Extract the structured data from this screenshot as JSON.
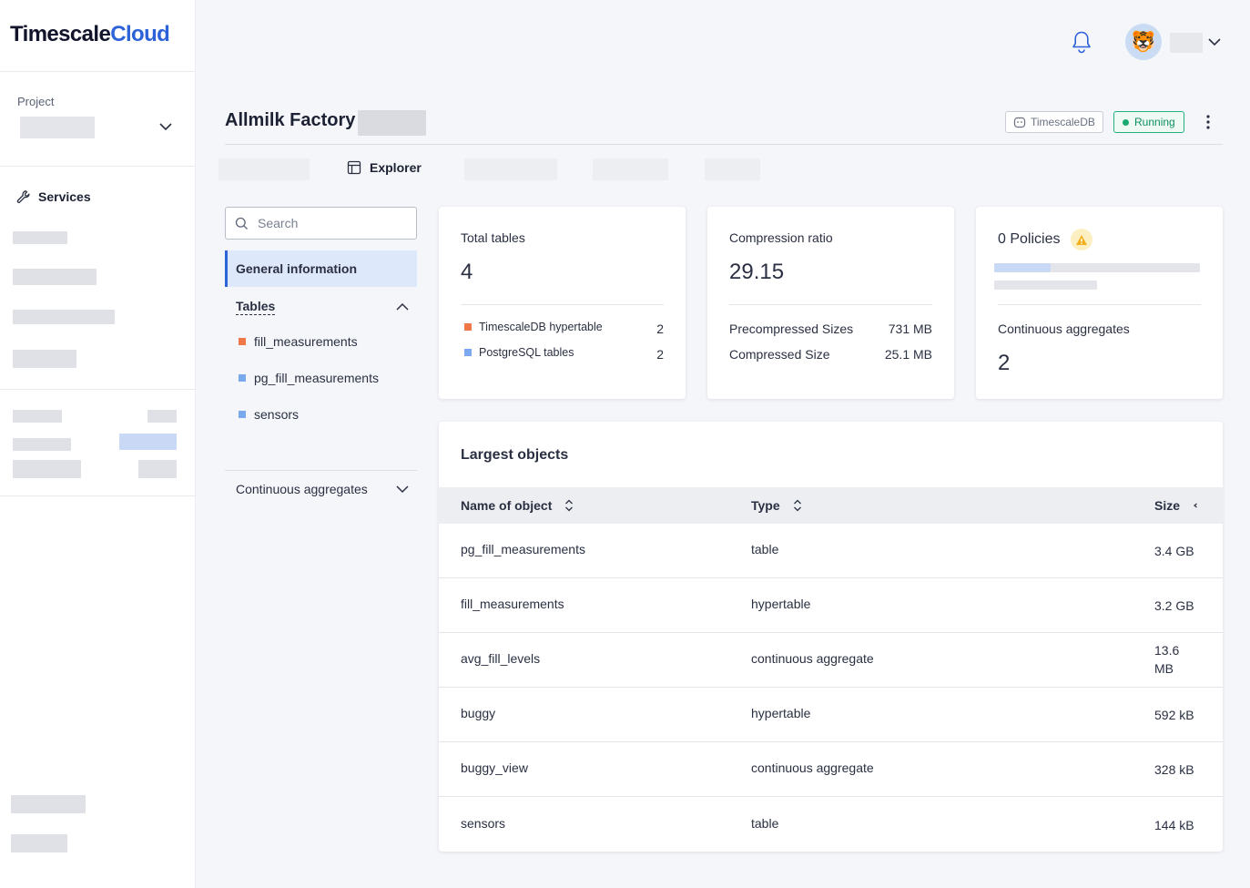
{
  "brand": {
    "name_part1": "Timescale",
    "name_part2": "Cloud"
  },
  "sidebar": {
    "project_label": "Project",
    "services_label": "Services"
  },
  "header": {
    "service_title": "Allmilk Factory",
    "engine_tag": "TimescaleDB",
    "status": "Running"
  },
  "tabs": {
    "explorer": "Explorer"
  },
  "explorer": {
    "search_placeholder": "Search",
    "general_information": "General information",
    "tables_heading": "Tables",
    "tables": [
      {
        "name": "fill_measurements",
        "kind": "hypertable",
        "color": "#f0774a"
      },
      {
        "name": "pg_fill_measurements",
        "kind": "table",
        "color": "#7aa9f0"
      },
      {
        "name": "sensors",
        "kind": "table",
        "color": "#7aa9f0"
      }
    ],
    "continuous_aggregates_heading": "Continuous aggregates"
  },
  "cards": {
    "total_tables": {
      "label": "Total tables",
      "value": "4",
      "legend": [
        {
          "label": "TimescaleDB hypertable",
          "count": "2",
          "color": "#f0774a"
        },
        {
          "label": "PostgreSQL tables",
          "count": "2",
          "color": "#7aa9f0"
        }
      ]
    },
    "compression": {
      "label": "Compression ratio",
      "value": "29.15",
      "rows": [
        {
          "label": "Precompressed Sizes",
          "value": "731 MB"
        },
        {
          "label": "Compressed Size",
          "value": "25.1 MB"
        }
      ]
    },
    "policies": {
      "title": "0 Policies",
      "cagg_label": "Continuous aggregates",
      "cagg_value": "2"
    }
  },
  "largest_objects": {
    "title": "Largest objects",
    "columns": {
      "name": "Name of object",
      "type": "Type",
      "size": "Size"
    },
    "rows": [
      {
        "name": "pg_fill_measurements",
        "type": "table",
        "size": "3.4 GB"
      },
      {
        "name": "fill_measurements",
        "type": "hypertable",
        "size": "3.2 GB"
      },
      {
        "name": "avg_fill_levels",
        "type": "continuous aggregate",
        "size": "13.6 MB"
      },
      {
        "name": "buggy",
        "type": "hypertable",
        "size": "592 kB"
      },
      {
        "name": "buggy_view",
        "type": "continuous aggregate",
        "size": "328 kB"
      },
      {
        "name": "sensors",
        "type": "table",
        "size": "144 kB"
      }
    ]
  },
  "colors": {
    "accent": "#2d63d8",
    "running": "#18a96f",
    "hypertable": "#f0774a",
    "pg_table": "#7aa9f0"
  }
}
